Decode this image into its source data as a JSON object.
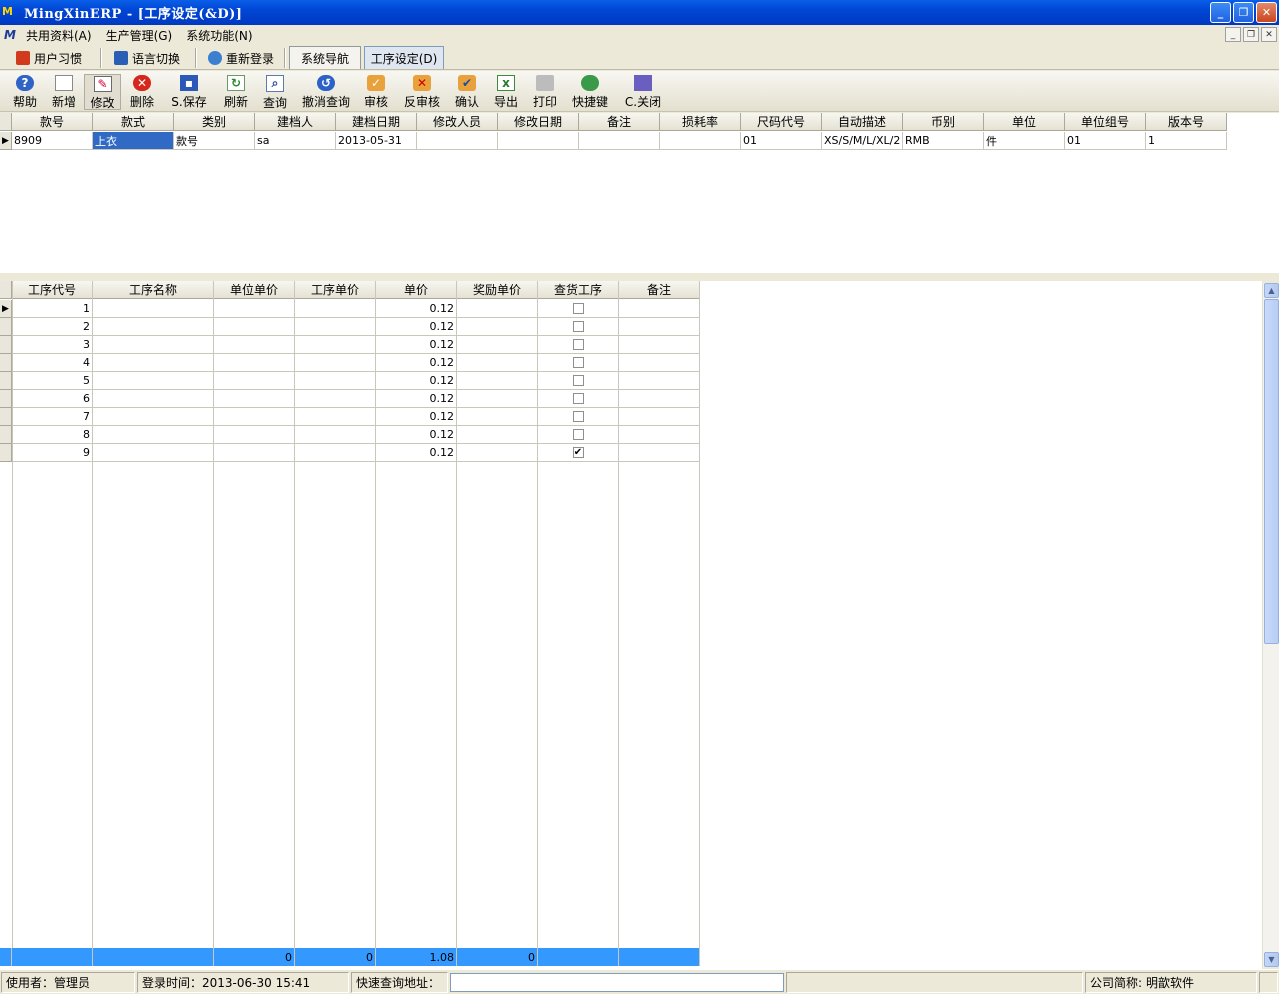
{
  "window": {
    "title": "MingXinERP - [工序设定(&D)]"
  },
  "menu": [
    "共用资料(A)",
    "生产管理(G)",
    "系统功能(N)"
  ],
  "tabbar": {
    "buttons": [
      "用户习惯",
      "语言切换",
      "重新登录"
    ],
    "tabs": [
      "系统导航",
      "工序设定(D)"
    ],
    "active_tab": "工序设定(D)"
  },
  "toolbar": [
    {
      "label": "帮助",
      "icon": "help-icon"
    },
    {
      "label": "新增",
      "icon": "new-document-icon"
    },
    {
      "label": "修改",
      "icon": "edit-icon"
    },
    {
      "label": "删除",
      "icon": "delete-icon"
    },
    {
      "label": "S.保存",
      "icon": "save-icon"
    },
    {
      "label": "刷新",
      "icon": "refresh-icon"
    },
    {
      "label": "查询",
      "icon": "query-icon"
    },
    {
      "label": "撤消查询",
      "icon": "undo-query-icon"
    },
    {
      "label": "审核",
      "icon": "audit-icon"
    },
    {
      "label": "反审核",
      "icon": "unaudit-icon"
    },
    {
      "label": "确认",
      "icon": "confirm-icon"
    },
    {
      "label": "导出",
      "icon": "export-excel-icon"
    },
    {
      "label": "打印",
      "icon": "print-icon"
    },
    {
      "label": "快捷键",
      "icon": "shortcut-icon"
    },
    {
      "label": "C.关闭",
      "icon": "close-door-icon"
    }
  ],
  "style_grid": {
    "headers": [
      "款号",
      "款式",
      "类别",
      "建档人",
      "建档日期",
      "修改人员",
      "修改日期",
      "备注",
      "损耗率",
      "尺码代号",
      "自动描述",
      "币别",
      "单位",
      "单位组号",
      "版本号"
    ],
    "rows": [
      [
        "8909",
        "上衣",
        "款号",
        "sa",
        "2013-05-31",
        "",
        "",
        "",
        "",
        "01",
        "XS/S/M/L/XL/2",
        "RMB",
        "件",
        "01",
        "1"
      ]
    ]
  },
  "process_grid": {
    "headers": [
      "工序代号",
      "工序名称",
      "单位单价",
      "工序单价",
      "单价",
      "奖励单价",
      "查货工序",
      "备注"
    ],
    "rows": [
      {
        "code": "1",
        "name": "",
        "unit_price": "",
        "proc_price": "",
        "price": "0.12",
        "bonus": "",
        "check": false,
        "note": ""
      },
      {
        "code": "2",
        "name": "",
        "unit_price": "",
        "proc_price": "",
        "price": "0.12",
        "bonus": "",
        "check": false,
        "note": ""
      },
      {
        "code": "3",
        "name": "",
        "unit_price": "",
        "proc_price": "",
        "price": "0.12",
        "bonus": "",
        "check": false,
        "note": ""
      },
      {
        "code": "4",
        "name": "",
        "unit_price": "",
        "proc_price": "",
        "price": "0.12",
        "bonus": "",
        "check": false,
        "note": ""
      },
      {
        "code": "5",
        "name": "",
        "unit_price": "",
        "proc_price": "",
        "price": "0.12",
        "bonus": "",
        "check": false,
        "note": ""
      },
      {
        "code": "6",
        "name": "",
        "unit_price": "",
        "proc_price": "",
        "price": "0.12",
        "bonus": "",
        "check": false,
        "note": ""
      },
      {
        "code": "7",
        "name": "",
        "unit_price": "",
        "proc_price": "",
        "price": "0.12",
        "bonus": "",
        "check": false,
        "note": ""
      },
      {
        "code": "8",
        "name": "",
        "unit_price": "",
        "proc_price": "",
        "price": "0.12",
        "bonus": "",
        "check": false,
        "note": ""
      },
      {
        "code": "9",
        "name": "",
        "unit_price": "",
        "proc_price": "",
        "price": "0.12",
        "bonus": "",
        "check": true,
        "note": ""
      }
    ],
    "totals": [
      "",
      "",
      "0",
      "0",
      "1.08",
      "0",
      "",
      ""
    ]
  },
  "status": {
    "user_label": "使用者：",
    "user": "管理员",
    "login_label": "登录时间：",
    "login_time": "2013-06-30 15:41",
    "quick_label": "快速查询地址：",
    "company_label": "公司简称:",
    "company": "明歆软件"
  },
  "colors": {
    "title_blue": "#0046d5",
    "selection": "#316ac5",
    "footer_row": "#3399ff"
  }
}
